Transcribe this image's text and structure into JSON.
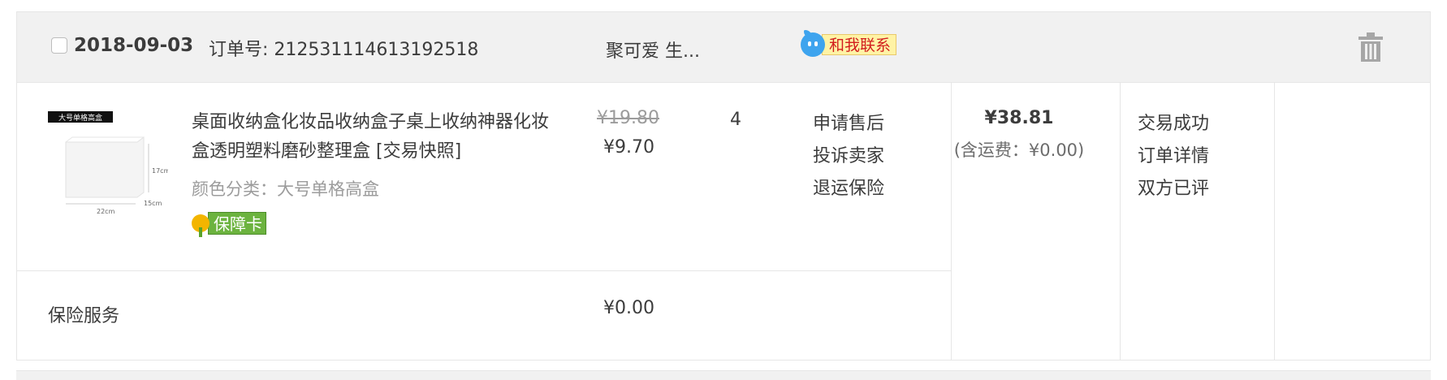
{
  "order": {
    "date": "2018-09-03",
    "order_number": "订单号: 212531114613192518",
    "shop_name": "聚可爱 生...",
    "contact_label": "和我联系",
    "item": {
      "title": "桌面收纳盒化妆品收纳盒子桌上收纳神器化妆盒透明塑料磨砂整理盒 [交易快照]",
      "spec": "颜色分类：大号单格高盒",
      "badge": "保障卡",
      "thumb_label": "大号单格高盒",
      "thumb_dims": {
        "height": "17cm",
        "width": "22cm",
        "depth": "15cm"
      },
      "original_price": "¥19.80",
      "price": "¥9.70",
      "quantity": "4"
    },
    "after_sale": [
      "申请售后",
      "投诉卖家",
      "退运保险"
    ],
    "total": "¥38.81",
    "shipping": "(含运费：¥0.00)",
    "status_links": [
      "交易成功",
      "订单详情",
      "双方已评"
    ],
    "insurance": {
      "label": "保险服务",
      "price": "¥0.00"
    }
  },
  "colors": {
    "header_bg": "#f1f1f1",
    "border": "#e6e6e6",
    "contact_bubble": "#3ea4ee",
    "contact_text": "#d21e1e",
    "badge_green": "#6cb33f"
  },
  "icons": {
    "delete": "trash-icon",
    "contact": "wangwang-icon",
    "badge": "flower-icon"
  }
}
